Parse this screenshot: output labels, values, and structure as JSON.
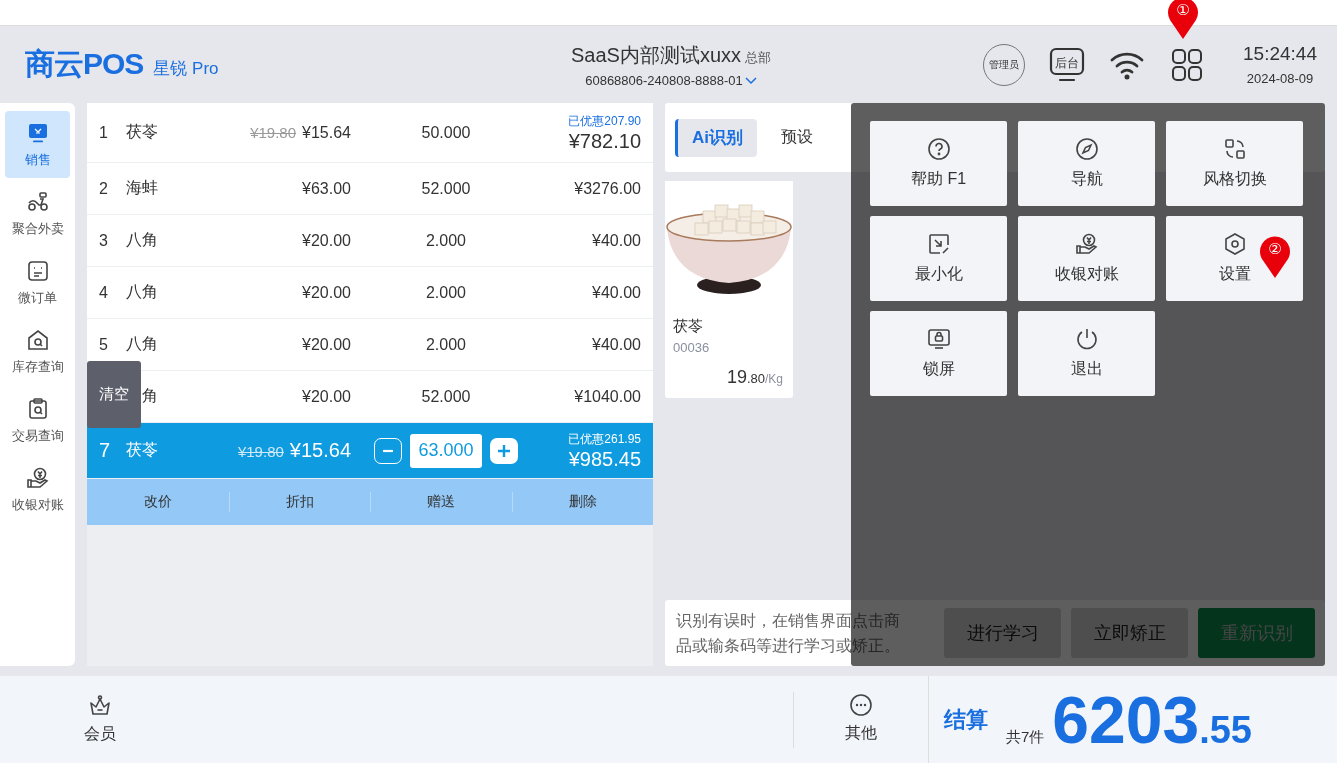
{
  "header": {
    "logo": "商云POS",
    "product": "星锐 Pro",
    "store": "SaaS内部测试xuxx",
    "store_tag": "总部",
    "terminal": "60868806-240808-8888-01",
    "admin": "管理员",
    "backend": "后台",
    "time": "15:24:44",
    "date": "2024-08-09"
  },
  "sidebar": {
    "items": [
      {
        "label": "销售",
        "selected": true
      },
      {
        "label": "聚合外卖",
        "selected": false
      },
      {
        "label": "微订单",
        "selected": false
      },
      {
        "label": "库存查询",
        "selected": false
      },
      {
        "label": "交易查询",
        "selected": false
      },
      {
        "label": "收银对账",
        "selected": false
      }
    ]
  },
  "order": {
    "rows": [
      {
        "index": "1",
        "name": "茯苓",
        "original_price": "¥19.80",
        "price": "¥15.64",
        "quantity": "50.000",
        "discount": "已优惠207.90",
        "total": "¥782.10",
        "selected": false
      },
      {
        "index": "2",
        "name": "海蚌",
        "price": "¥63.00",
        "quantity": "52.000",
        "total": "¥3276.00",
        "selected": false
      },
      {
        "index": "3",
        "name": "八角",
        "price": "¥20.00",
        "quantity": "2.000",
        "total": "¥40.00",
        "selected": false
      },
      {
        "index": "4",
        "name": "八角",
        "price": "¥20.00",
        "quantity": "2.000",
        "total": "¥40.00",
        "selected": false
      },
      {
        "index": "5",
        "name": "八角",
        "price": "¥20.00",
        "quantity": "2.000",
        "total": "¥40.00",
        "selected": false
      },
      {
        "name": "角",
        "price": "¥20.00",
        "quantity": "52.000",
        "total": "¥1040.00",
        "selected": false
      },
      {
        "index": "7",
        "name": "茯苓",
        "original_price": "¥19.80",
        "price": "¥15.64",
        "quantity": "63.000",
        "discount": "已优惠261.95",
        "total": "¥985.45",
        "selected": true
      }
    ],
    "actions": [
      "改价",
      "折扣",
      "赠送",
      "删除"
    ],
    "clear_button": "清空"
  },
  "recognition": {
    "tabs": [
      {
        "label": "Ai识别",
        "selected": true
      },
      {
        "label": "预设",
        "selected": false
      }
    ],
    "products": [
      {
        "kind": "picture",
        "name": "茯苓",
        "code": "00036",
        "price": "19",
        "price_decimals": ".80",
        "unit": "/Kg"
      }
    ],
    "hint": "识别有误时，在销售界面点击商品或输条码等进行学习或矫正。",
    "buttons": [
      {
        "label": "进行学习",
        "kind": "plain"
      },
      {
        "label": "立即矫正",
        "kind": "plain"
      },
      {
        "label": "重新识别",
        "kind": "primary"
      }
    ]
  },
  "menu": {
    "items": [
      {
        "label": "帮助 F1"
      },
      {
        "label": "导航"
      },
      {
        "label": "风格切换"
      },
      {
        "label": "最小化"
      },
      {
        "label": "收银对账"
      },
      {
        "label": "设置"
      },
      {
        "label": "锁屏"
      },
      {
        "label": "退出"
      }
    ]
  },
  "markers": [
    {
      "label": "①"
    },
    {
      "label": "②"
    }
  ],
  "footer": {
    "member": "会员",
    "other": "其他",
    "checkout": "结算",
    "count": "共7件",
    "total": "6203",
    "total_decimals": ".55"
  }
}
